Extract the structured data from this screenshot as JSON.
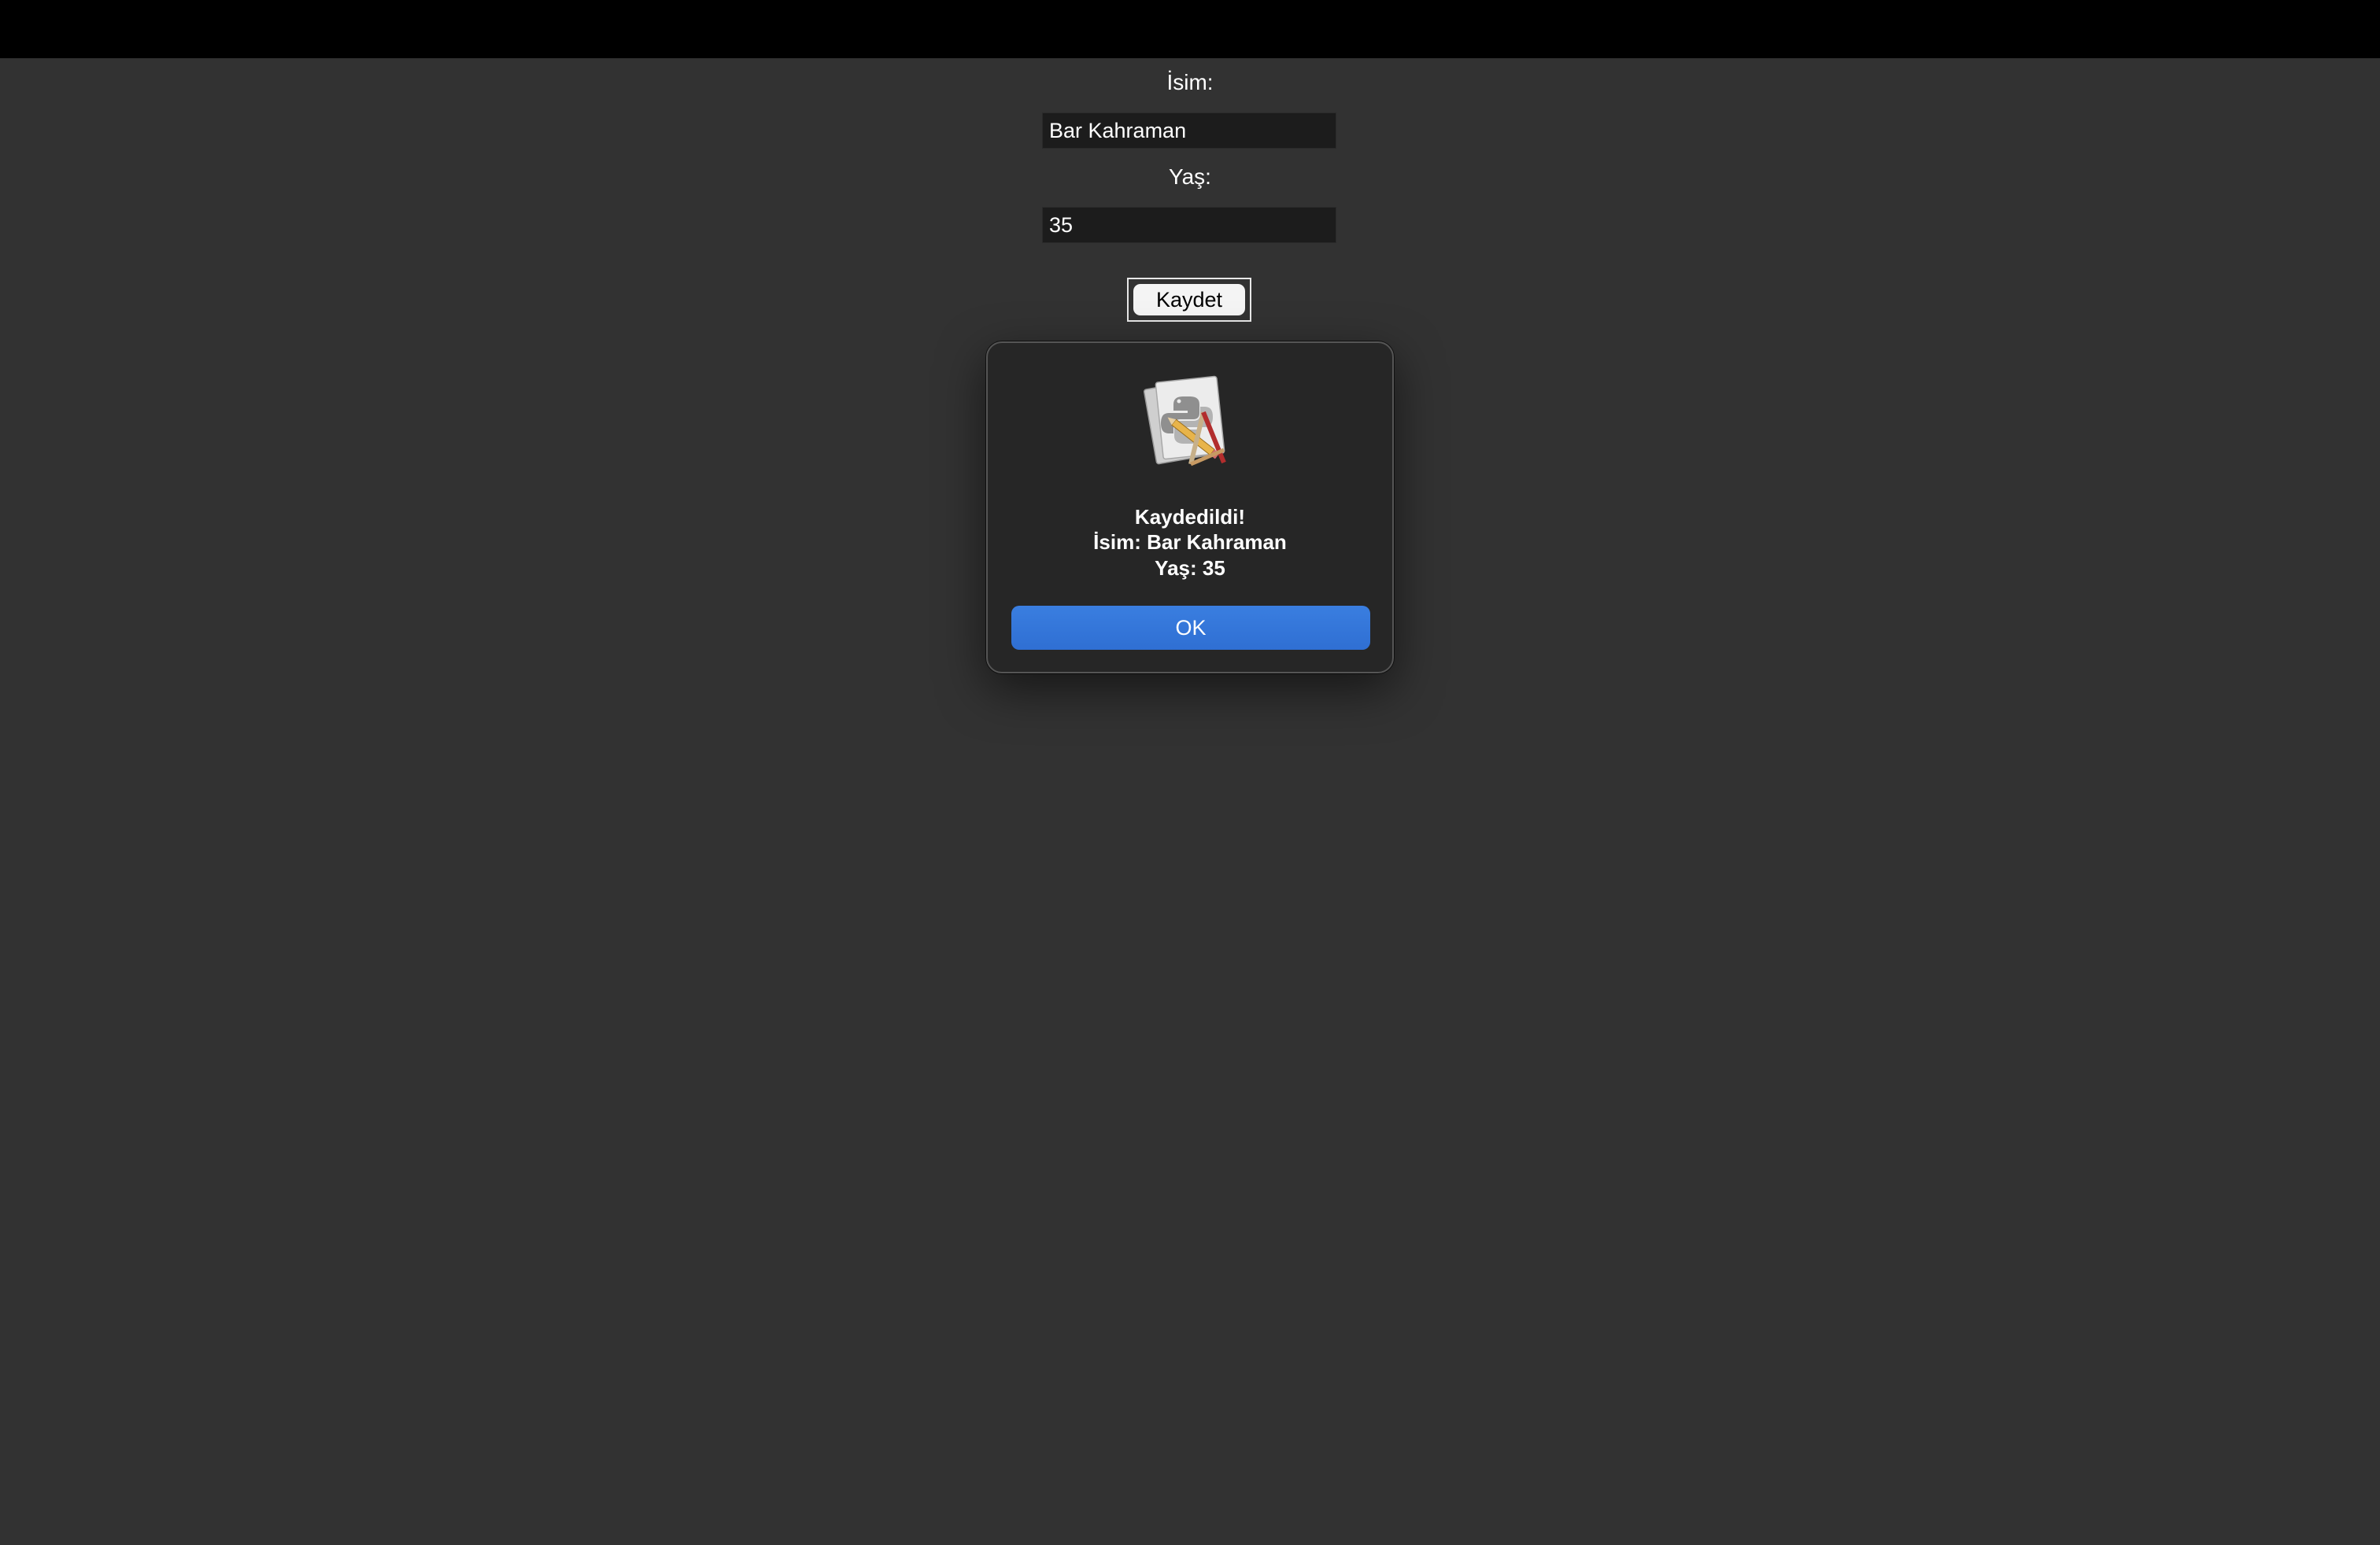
{
  "form": {
    "name_label": "İsim:",
    "name_value": "Bar Kahraman",
    "age_label": "Yaş:",
    "age_value": "35",
    "save_label": "Kaydet"
  },
  "dialog": {
    "icon": "python-launcher-icon",
    "line1": "Kaydedildi!",
    "line2": "İsim: Bar Kahraman",
    "line3": "Yaş: 35",
    "ok_label": "OK"
  },
  "colors": {
    "background": "#323232",
    "accent": "#2f6fd3"
  }
}
